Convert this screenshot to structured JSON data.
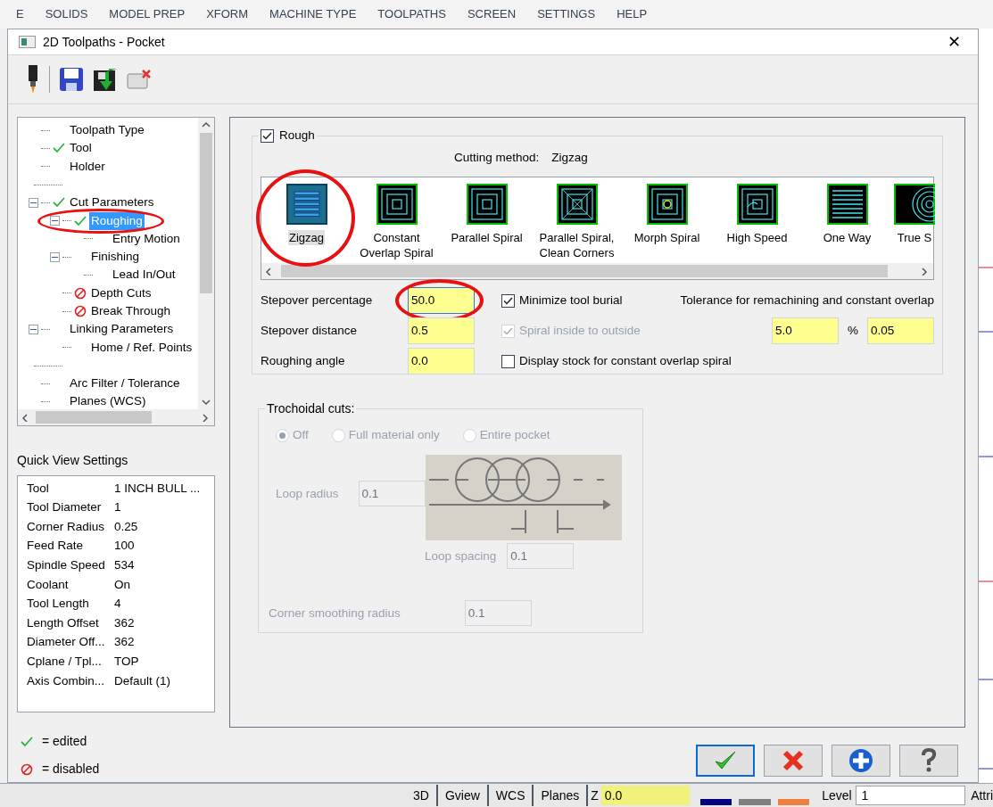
{
  "menu_bar": [
    "E",
    "SOLIDS",
    "MODEL PREP",
    "XFORM",
    "MACHINE TYPE",
    "TOOLPATHS",
    "SCREEN",
    "SETTINGS",
    "HELP"
  ],
  "window": {
    "title": "2D Toolpaths - Pocket",
    "close": "✕"
  },
  "tree": [
    {
      "kind": "item",
      "label": "Toolpath Type",
      "edited": false,
      "disabled": false,
      "selected": false
    },
    {
      "kind": "item",
      "label": "Tool",
      "edited": true,
      "disabled": false,
      "selected": false
    },
    {
      "kind": "item",
      "label": "Holder",
      "edited": false,
      "disabled": false,
      "selected": false
    },
    {
      "kind": "spacer"
    },
    {
      "kind": "item",
      "label": "Cut Parameters",
      "edited": true,
      "disabled": false,
      "selected": false,
      "expanded": true,
      "children": [
        {
          "kind": "item",
          "label": "Roughing",
          "edited": true,
          "disabled": false,
          "selected": true,
          "annotated": true,
          "expanded": true,
          "children": [
            {
              "kind": "item",
              "label": "Entry Motion",
              "edited": false,
              "disabled": false,
              "selected": false
            }
          ]
        },
        {
          "kind": "item",
          "label": "Finishing",
          "edited": false,
          "disabled": false,
          "selected": false,
          "expanded": true,
          "children": [
            {
              "kind": "item",
              "label": "Lead In/Out",
              "edited": false,
              "disabled": false,
              "selected": false
            }
          ]
        },
        {
          "kind": "item",
          "label": "Depth Cuts",
          "edited": false,
          "disabled": true,
          "selected": false
        },
        {
          "kind": "item",
          "label": "Break Through",
          "edited": false,
          "disabled": true,
          "selected": false
        }
      ]
    },
    {
      "kind": "item",
      "label": "Linking Parameters",
      "edited": false,
      "disabled": false,
      "selected": false,
      "expanded": true,
      "children": [
        {
          "kind": "item",
          "label": "Home / Ref. Points",
          "edited": false,
          "disabled": false,
          "selected": false
        }
      ]
    },
    {
      "kind": "spacer"
    },
    {
      "kind": "item",
      "label": "Arc Filter / Tolerance",
      "edited": false,
      "disabled": false,
      "selected": false
    },
    {
      "kind": "item",
      "label": "Planes (WCS)",
      "edited": false,
      "disabled": false,
      "selected": false
    }
  ],
  "quick_view": {
    "title": "Quick View Settings",
    "rows": [
      {
        "key": "Tool",
        "value": "1 INCH BULL ..."
      },
      {
        "key": "Tool Diameter",
        "value": "1"
      },
      {
        "key": "Corner Radius",
        "value": "0.25"
      },
      {
        "key": "Feed Rate",
        "value": "100"
      },
      {
        "key": "Spindle Speed",
        "value": "534"
      },
      {
        "key": "Coolant",
        "value": "On"
      },
      {
        "key": "Tool Length",
        "value": "4"
      },
      {
        "key": "Length Offset",
        "value": "362"
      },
      {
        "key": "Diameter Off...",
        "value": "362"
      },
      {
        "key": "Cplane / Tpl...",
        "value": "TOP"
      },
      {
        "key": "Axis Combin...",
        "value": "Default (1)"
      }
    ]
  },
  "legend": [
    {
      "kind": "edited",
      "label": "= edited"
    },
    {
      "kind": "disabled",
      "label": "= disabled"
    }
  ],
  "rough": {
    "label": "Rough",
    "checked": true,
    "cutting_method_label": "Cutting method:",
    "cutting_method": "Zigzag",
    "methods": [
      {
        "label": "Zigzag",
        "kind": "zigzag",
        "selected": true,
        "annotated": true
      },
      {
        "label": "Constant Overlap Spiral",
        "kind": "spiral",
        "selected": false,
        "annotated": false
      },
      {
        "label": "Parallel Spiral",
        "kind": "spiral",
        "selected": false,
        "annotated": false
      },
      {
        "label": "Parallel Spiral, Clean Corners",
        "kind": "corners",
        "selected": false,
        "annotated": false
      },
      {
        "label": "Morph Spiral",
        "kind": "morph",
        "selected": false,
        "annotated": false
      },
      {
        "label": "High Speed",
        "kind": "highspeed",
        "selected": false,
        "annotated": false
      },
      {
        "label": "One Way",
        "kind": "oneway",
        "selected": false,
        "annotated": false
      },
      {
        "label": "True S",
        "kind": "true",
        "selected": false,
        "annotated": false
      }
    ],
    "fields": [
      {
        "label": "Stepover percentage",
        "value": "50.0",
        "focused": true,
        "annotated": true
      },
      {
        "label": "Stepover distance",
        "value": "0.5",
        "focused": false,
        "annotated": false
      },
      {
        "label": "Roughing angle",
        "value": "0.0",
        "focused": false,
        "annotated": false
      }
    ],
    "options": [
      {
        "label": "Minimize tool burial",
        "checked": true,
        "disabled": false
      },
      {
        "label": "Spiral inside to outside",
        "checked": true,
        "disabled": true
      },
      {
        "label": "Display stock for constant overlap spiral",
        "checked": false,
        "disabled": false
      }
    ],
    "tolerance": {
      "label": "Tolerance for remachining and constant overlap",
      "percent": "5.0",
      "unit": "%",
      "value": "0.05"
    }
  },
  "trochoidal": {
    "title": "Trochoidal cuts:",
    "disabled": true,
    "radios": [
      {
        "label": "Off",
        "selected": true
      },
      {
        "label": "Full material only",
        "selected": false
      },
      {
        "label": "Entire pocket",
        "selected": false
      }
    ],
    "loop_radius": {
      "label": "Loop radius",
      "value": "0.1"
    },
    "loop_spacing": {
      "label": "Loop spacing",
      "value": "0.1"
    },
    "corner_smoothing": {
      "label": "Corner smoothing radius",
      "value": "0.1"
    }
  },
  "buttons": [
    {
      "kind": "ok",
      "default": true
    },
    {
      "kind": "cancel",
      "default": false
    },
    {
      "kind": "add",
      "default": false
    },
    {
      "kind": "help",
      "default": false
    }
  ],
  "status_bar": {
    "items": [
      "3D",
      "Gview",
      "WCS",
      "Planes"
    ],
    "z_label": "Z",
    "z_value": "0.0",
    "swatches": [
      {
        "color": "#000080"
      },
      {
        "color": "#808080"
      },
      {
        "color": "#f08040"
      }
    ],
    "level_label": "Level",
    "level_value": "1",
    "attrib": "Attri"
  }
}
